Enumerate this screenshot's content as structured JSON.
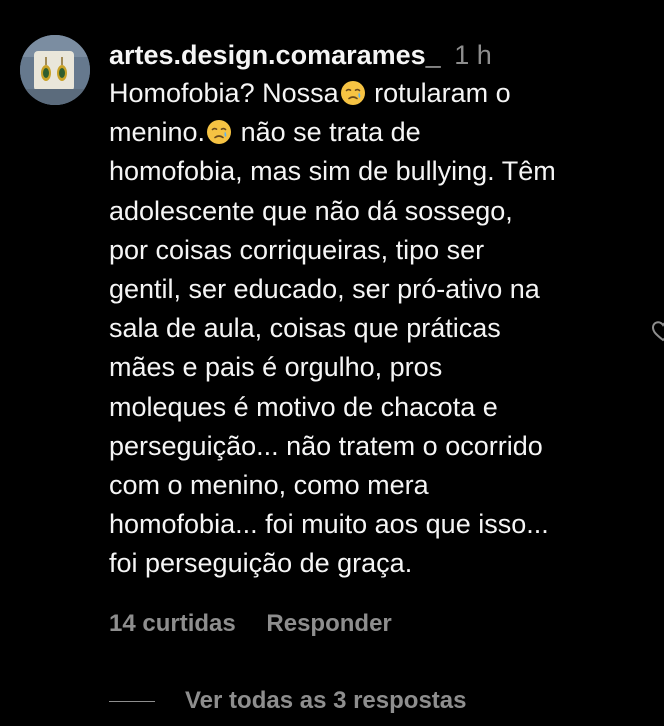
{
  "comment": {
    "username": "artes.design.comarames_",
    "timestamp": "1 h",
    "text_lines": [
      [
        "Homofobia? Nossa",
        "crying-face-emoji",
        " rotularam o"
      ],
      [
        "menino.",
        "crying-face-emoji",
        " não se trata de"
      ],
      [
        "homofobia, mas sim de bullying. Têm"
      ],
      [
        "adolescente que não dá sossego,"
      ],
      [
        "por coisas corriqueiras, tipo ser"
      ],
      [
        "gentil, ser educado, ser pró-ativo na"
      ],
      [
        "sala de aula, coisas que práticas"
      ],
      [
        "mães e pais é orgulho, pros"
      ],
      [
        "moleques é motivo de chacota e"
      ],
      [
        "perseguição... não tratem o ocorrido"
      ],
      [
        "com o menino, como mera"
      ],
      [
        "homofobia... foi muito aos que isso..."
      ],
      [
        "foi perseguição de graça."
      ]
    ],
    "likes_label": "14 curtidas",
    "reply_label": "Responder"
  },
  "replies": {
    "view_all_label": "Ver todas as 3 respostas"
  },
  "icons": {
    "avatar": "earrings-photo-avatar",
    "emoji": "crying-face-emoji",
    "like": "heart-icon"
  },
  "colors": {
    "background": "#000000",
    "primary_text": "#f5f5f5",
    "secondary_text": "#8e8e8e"
  }
}
